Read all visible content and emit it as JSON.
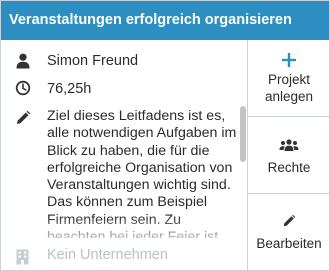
{
  "header": {
    "title": "Veranstaltungen erfolgreich organisieren"
  },
  "details": {
    "person": "Simon Freund",
    "duration": "76,25h",
    "description": "Ziel dieses Leitfadens ist es, alle notwendigen Aufgaben im Blick zu haben, die für die erfolgreiche Organisation von Veranstaltungen wichtig sind. Das können zum Beispiel Firmenfeiern sein. Zu beachten bei jeder Feier ist eine",
    "company": "Kein Unternehmen"
  },
  "actions": {
    "create_project": "Projekt anlegen",
    "rights": "Rechte",
    "edit": "Bearbeiten"
  },
  "colors": {
    "header_bg": "#2d8fc1",
    "icon": "#333333",
    "accent": "#2d8fc1",
    "muted": "#b9c1c8"
  },
  "icons": {
    "person": "user-icon",
    "duration": "clock-icon",
    "description": "pencil-icon",
    "company": "building-icon",
    "create_project": "plus-icon",
    "rights": "users-icon",
    "edit": "pencil-icon"
  }
}
